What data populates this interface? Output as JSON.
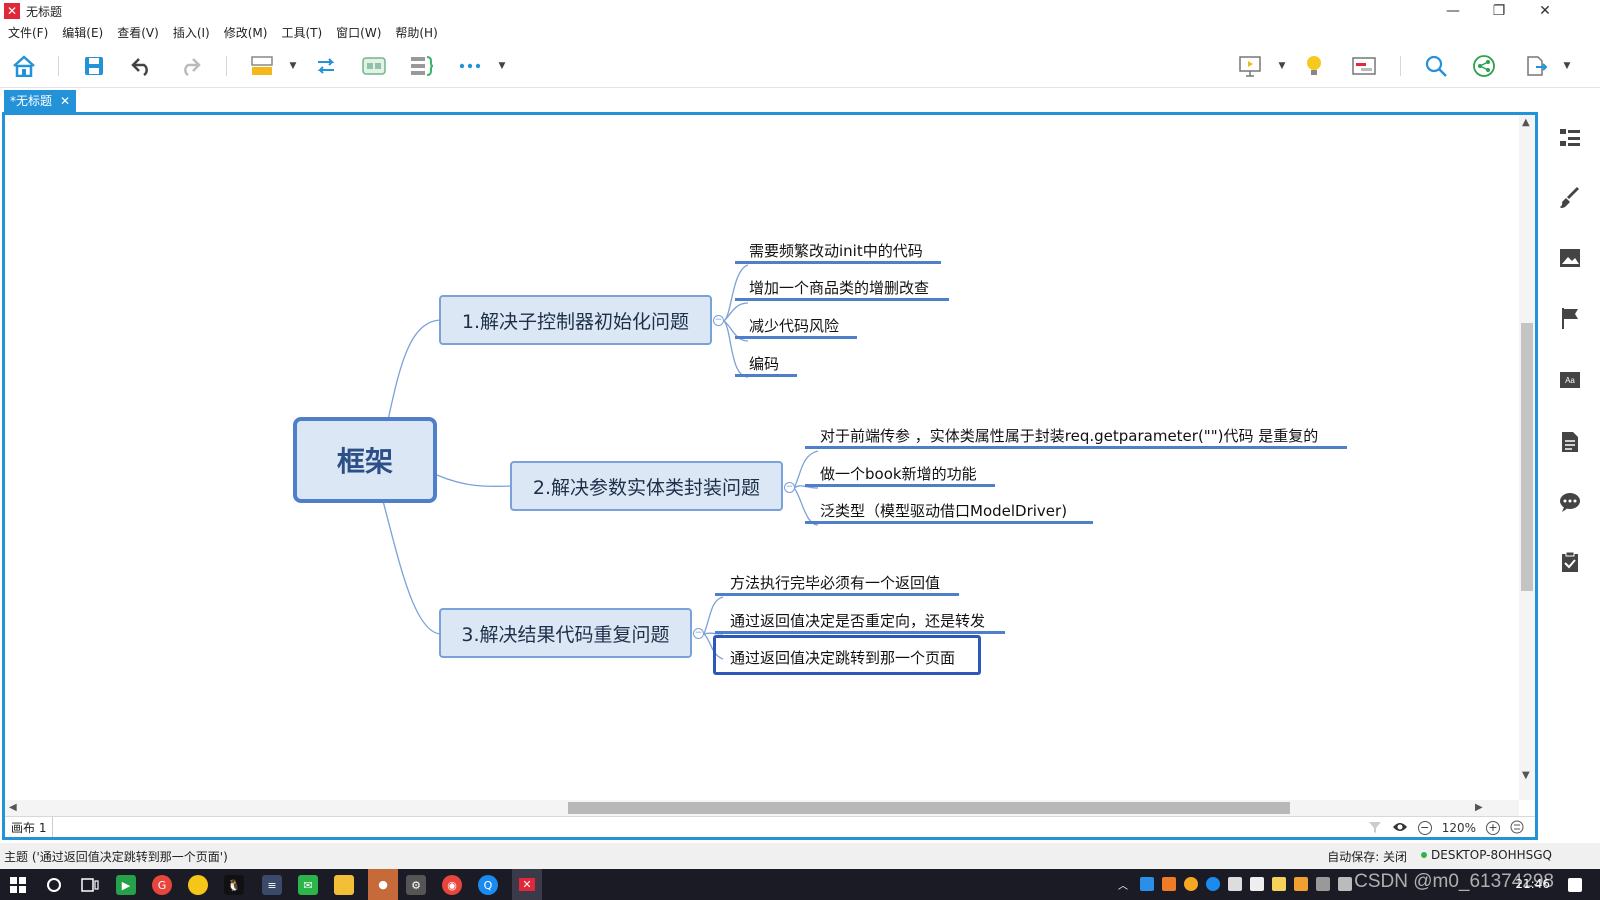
{
  "window": {
    "title": "无标题",
    "minimize": "—",
    "maximize": "❐",
    "close": "✕"
  },
  "menu": [
    "文件(F)",
    "编辑(E)",
    "查看(V)",
    "插入(I)",
    "修改(M)",
    "工具(T)",
    "窗口(W)",
    "帮助(H)"
  ],
  "tab": {
    "label": "*无标题",
    "close": "✕"
  },
  "mindmap": {
    "root": "框架",
    "branches": [
      {
        "label": "1.解决子控制器初始化问题",
        "children": [
          "需要频繁改动init中的代码",
          "增加一个商品类的增删改查",
          "减少代码风险",
          "编码"
        ]
      },
      {
        "label": "2.解决参数实体类封装问题",
        "children": [
          "对于前端传参    ，实体类属性属于封装req.getparameter(\"\")代码 是重复的",
          "做一个book新增的功能",
          "泛类型（模型驱动借口ModelDriver)"
        ]
      },
      {
        "label": "3.解决结果代码重复问题",
        "children": [
          "方法执行完毕必须有一个返回值",
          "通过返回值决定是否重定向，还是转发",
          "通过返回值决定跳转到那一个页面"
        ]
      }
    ],
    "collapse_symbol": "−"
  },
  "canvas_bar": {
    "sheet": "画布 1",
    "zoom": "120%",
    "zoom_out": "−",
    "zoom_in": "+"
  },
  "status": {
    "topic": "主题 ('通过返回值决定跳转到那一个页面')",
    "autosave": "自动保存: 关闭",
    "machine": "DESKTOP-8OHHSGQ"
  },
  "taskbar": {
    "clock": "21:46",
    "watermark": "CSDN @m0_61374298"
  },
  "colors": {
    "accent": "#2492d8",
    "node_border": "#4f7fc9",
    "node_fill": "#dce7f5",
    "leaf_underline": "#4f7fc9",
    "brand_red": "#e0283a"
  },
  "icons": {
    "toolbar": [
      "home-icon",
      "save-icon",
      "undo-icon",
      "redo-icon",
      "topic-icon",
      "relationship-icon",
      "boundary-icon",
      "summary-icon",
      "more-icon",
      "presentation-icon",
      "brainstorm-icon",
      "gantt-icon",
      "search-icon",
      "share-icon",
      "export-icon"
    ],
    "right_panel": [
      "outline-icon",
      "format-icon",
      "image-icon",
      "marker-icon",
      "text-format-icon",
      "notes-icon",
      "comment-icon",
      "task-icon"
    ]
  }
}
